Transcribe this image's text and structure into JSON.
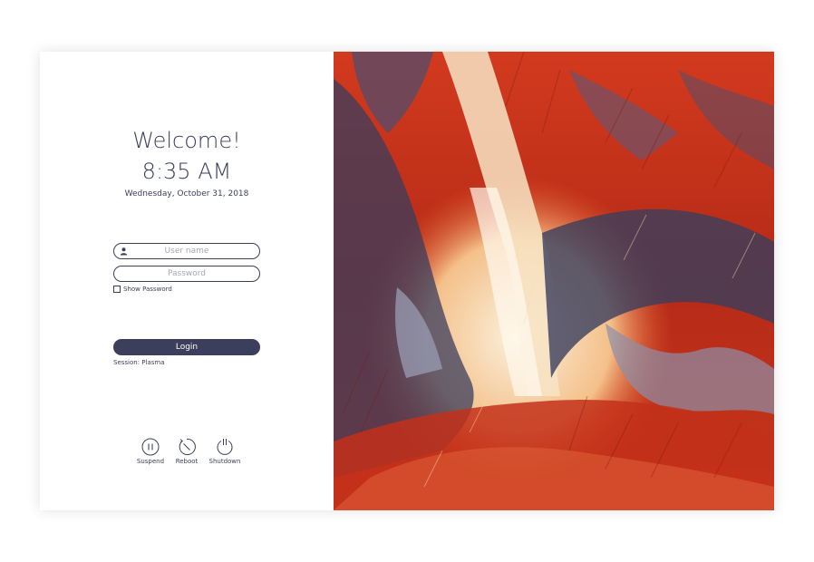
{
  "greeting": "Welcome!",
  "clock": {
    "time": "8:35 AM",
    "date": "Wednesday, October 31, 2018"
  },
  "login_form": {
    "username_placeholder": "User name",
    "password_placeholder": "Password",
    "show_password_label": "Show Password",
    "login_label": "Login",
    "session_label": "Session: Plasma"
  },
  "power_actions": [
    {
      "label": "Suspend",
      "icon": "pause-circle-icon"
    },
    {
      "label": "Reboot",
      "icon": "reboot-icon"
    },
    {
      "label": "Shutdown",
      "icon": "power-icon"
    }
  ],
  "colors": {
    "accent": "#3b3f5c",
    "background": "#ffffff",
    "wallpaper_primary": "#c9321b",
    "wallpaper_dark": "#3a3e5e",
    "wallpaper_light": "#f7ead2"
  },
  "wallpaper": {
    "description_icon": "fractal-wallpaper"
  }
}
